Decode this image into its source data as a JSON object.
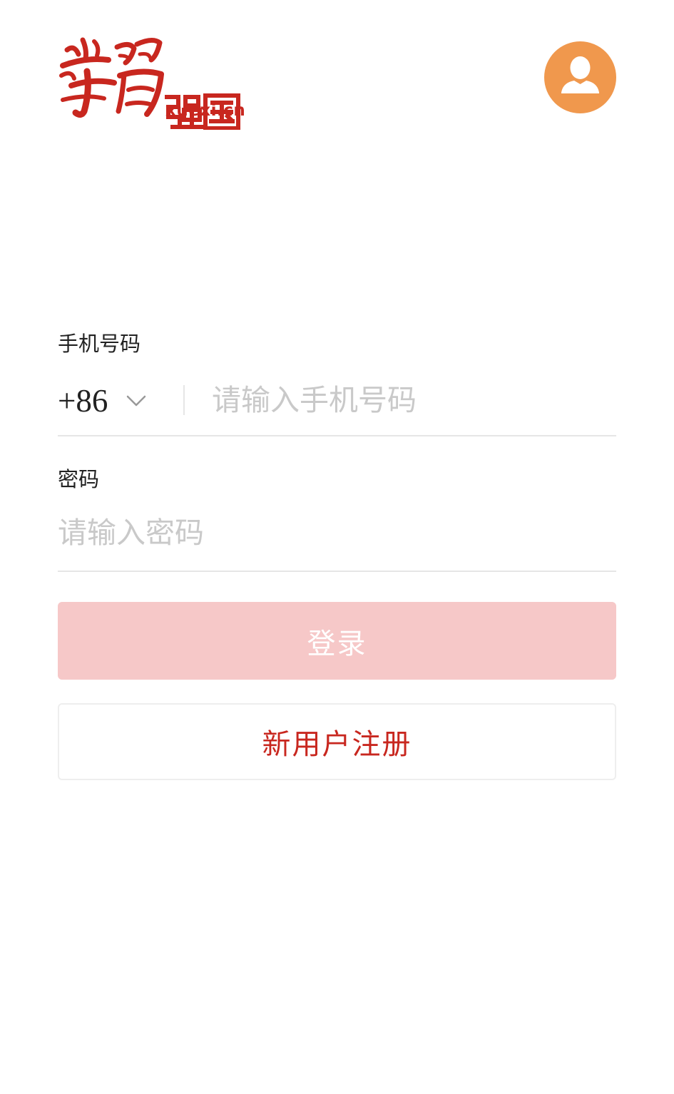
{
  "header": {
    "logo_text": "學習强国",
    "logo_url": "xuexi.cn",
    "avatar_icon": "user-icon",
    "brand_color": "#c8271f",
    "avatar_color": "#f0984d"
  },
  "form": {
    "phone_label": "手机号码",
    "country_code": "+86",
    "country_code_icon": "chevron-down-icon",
    "phone_placeholder": "请输入手机号码",
    "phone_value": "",
    "password_label": "密码",
    "password_placeholder": "请输入密码",
    "password_value": ""
  },
  "actions": {
    "login_label": "登录",
    "login_color": "#f6c8c8",
    "register_label": "新用户注册"
  }
}
